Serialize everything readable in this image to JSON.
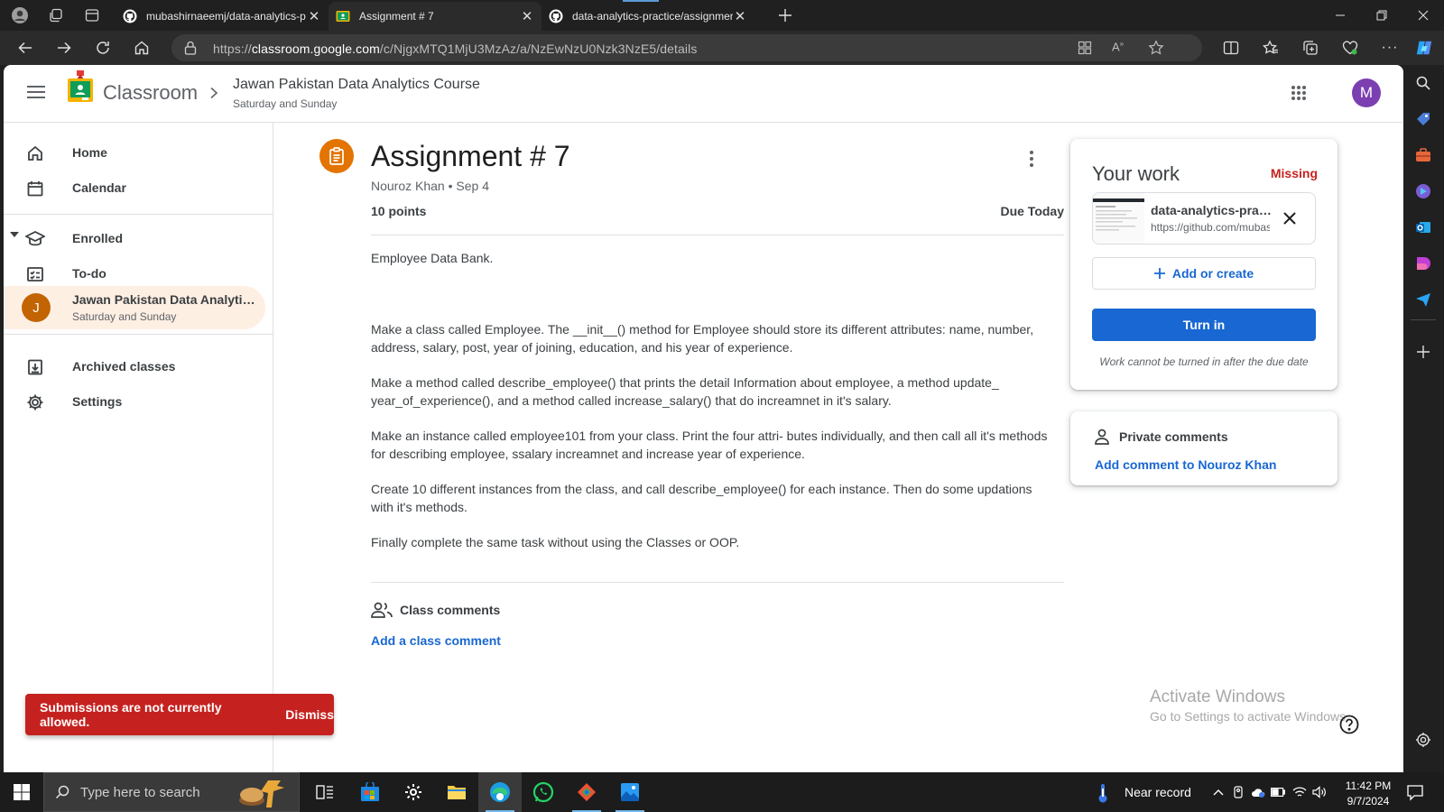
{
  "browser": {
    "tabs": [
      {
        "title": "mubashirnaeemj/data-analytics-p",
        "favicon": "github-icon"
      },
      {
        "title": "Assignment # 7",
        "favicon": "classroom-icon",
        "active": true
      },
      {
        "title": "data-analytics-practice/assignmer",
        "favicon": "github-icon"
      }
    ],
    "url_scheme": "https://",
    "url_host": "classroom.google.com",
    "url_path": "/c/NjgxMTQ1MjU3MzAz/a/NzEwNzU0Nzk3NzE5/details"
  },
  "header": {
    "app_name": "Classroom",
    "course_title": "Jawan Pakistan Data Analytics Course",
    "course_subtitle": "Saturday and Sunday",
    "avatar_letter": "M"
  },
  "sidebar": {
    "home": "Home",
    "calendar": "Calendar",
    "enrolled": "Enrolled",
    "todo": "To-do",
    "class_item": {
      "letter": "J",
      "name": "Jawan Pakistan Data Analytics Course",
      "subtitle": "Saturday and Sunday"
    },
    "archived": "Archived classes",
    "settings": "Settings"
  },
  "assignment": {
    "title": "Assignment # 7",
    "meta": "Nouroz Khan • Sep 4",
    "points": "10 points",
    "due": "Due Today",
    "description": [
      "Employee Data Bank.",
      "Make a class called Employee. The __init__() method for Employee should store its different attributes: name, number, address, salary, post, year of joining, education, and his year of experience.",
      "Make a method called describe_employee() that prints the detail Information about employee, a method update_ year_of_experience(), and a method called increase_salary() that do increamnet in it's salary.",
      "Make an instance called employee101 from your class. Print the four attri- butes individually, and then call all it's methods for describing employee, ssalary increamnet and increase year of experience.",
      "Create 10 different instances from the class, and call describe_employee() for each instance. Then do some updations with it's methods.",
      "Finally complete the same task without using the Classes or OOP."
    ],
    "class_comments_label": "Class comments",
    "add_class_comment": "Add a class comment"
  },
  "your_work": {
    "title": "Your work",
    "status": "Missing",
    "attachment_name": "data-analytics-practice",
    "attachment_url": "https://github.com/mubashirnaeemj",
    "add_or_create": "Add or create",
    "turn_in": "Turn in",
    "note": "Work cannot be turned in after the due date"
  },
  "private_comments": {
    "label": "Private comments",
    "add_link": "Add comment to Nouroz Khan"
  },
  "snackbar": {
    "message": "Submissions are not currently allowed.",
    "action": "Dismiss"
  },
  "watermark": {
    "title": "Activate Windows",
    "subtitle": "Go to Settings to activate Windows."
  },
  "taskbar": {
    "search_placeholder": "Type here to search",
    "weather": "Near record",
    "time": "11:42 PM",
    "date": "9/7/2024"
  },
  "colors": {
    "accent_blue": "#1967d2",
    "missing_red": "#c5221f",
    "assignment_orange": "#e37400",
    "avatar_purple": "#7b3fb1"
  }
}
